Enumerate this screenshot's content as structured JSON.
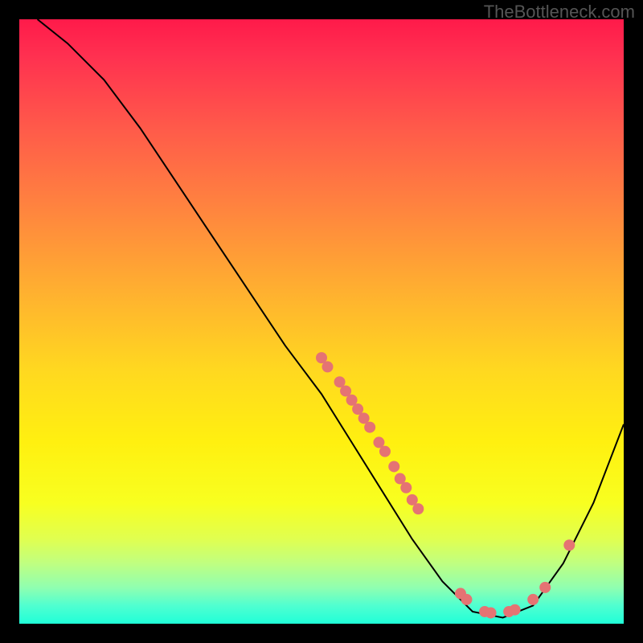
{
  "watermark": "TheBottleneck.com",
  "chart_data": {
    "type": "line",
    "title": "",
    "xlabel": "",
    "ylabel": "",
    "xlim": [
      0,
      100
    ],
    "ylim": [
      0,
      100
    ],
    "curve": [
      {
        "x": 3,
        "y": 100
      },
      {
        "x": 8,
        "y": 96
      },
      {
        "x": 14,
        "y": 90
      },
      {
        "x": 20,
        "y": 82
      },
      {
        "x": 28,
        "y": 70
      },
      {
        "x": 36,
        "y": 58
      },
      {
        "x": 44,
        "y": 46
      },
      {
        "x": 50,
        "y": 38
      },
      {
        "x": 55,
        "y": 30
      },
      {
        "x": 60,
        "y": 22
      },
      {
        "x": 65,
        "y": 14
      },
      {
        "x": 70,
        "y": 7
      },
      {
        "x": 75,
        "y": 2
      },
      {
        "x": 80,
        "y": 1
      },
      {
        "x": 85,
        "y": 3
      },
      {
        "x": 90,
        "y": 10
      },
      {
        "x": 95,
        "y": 20
      },
      {
        "x": 100,
        "y": 33
      }
    ],
    "highlight_points": [
      {
        "x": 50,
        "y": 44
      },
      {
        "x": 51,
        "y": 42.5
      },
      {
        "x": 53,
        "y": 40
      },
      {
        "x": 54,
        "y": 38.5
      },
      {
        "x": 55,
        "y": 37
      },
      {
        "x": 56,
        "y": 35.5
      },
      {
        "x": 57,
        "y": 34
      },
      {
        "x": 58,
        "y": 32.5
      },
      {
        "x": 59.5,
        "y": 30
      },
      {
        "x": 60.5,
        "y": 28.5
      },
      {
        "x": 62,
        "y": 26
      },
      {
        "x": 63,
        "y": 24
      },
      {
        "x": 64,
        "y": 22.5
      },
      {
        "x": 65,
        "y": 20.5
      },
      {
        "x": 66,
        "y": 19
      },
      {
        "x": 73,
        "y": 5
      },
      {
        "x": 74,
        "y": 4
      },
      {
        "x": 77,
        "y": 2
      },
      {
        "x": 78,
        "y": 1.8
      },
      {
        "x": 81,
        "y": 2
      },
      {
        "x": 82,
        "y": 2.3
      },
      {
        "x": 85,
        "y": 4
      },
      {
        "x": 87,
        "y": 6
      },
      {
        "x": 91,
        "y": 13
      }
    ],
    "gradient_colors": {
      "top": "#ff1a4a",
      "mid": "#fff010",
      "bottom": "#20ffd8"
    }
  }
}
